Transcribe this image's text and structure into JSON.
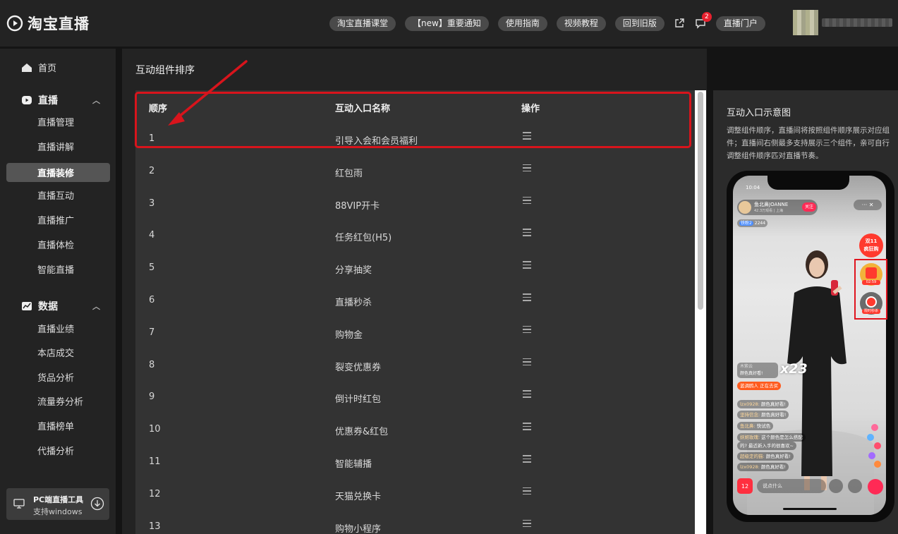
{
  "header": {
    "logo_text": "淘宝直播",
    "nav": [
      "淘宝直播课堂",
      "【new】重要通知",
      "使用指南",
      "视频教程",
      "回到旧版"
    ],
    "message_badge": "2",
    "portal_label": "直播门户"
  },
  "sidebar": {
    "home": "首页",
    "groups": [
      {
        "label": "直播",
        "items": [
          "直播管理",
          "直播讲解",
          "直播装修",
          "直播互动",
          "直播推广",
          "直播体检",
          "智能直播"
        ],
        "active": "直播装修"
      },
      {
        "label": "数据",
        "items": [
          "直播业绩",
          "本店成交",
          "货品分析",
          "流量券分析",
          "直播榜单",
          "代播分析"
        ]
      }
    ],
    "pc_tool": {
      "title": "PC端直播工具",
      "subtitle": "支持windows"
    }
  },
  "main": {
    "title": "互动组件排序",
    "columns": [
      "顺序",
      "互动入口名称",
      "操作"
    ],
    "rows": [
      {
        "order": "1",
        "name": "引导入会和会员福利"
      },
      {
        "order": "2",
        "name": "红包雨"
      },
      {
        "order": "3",
        "name": "88VIP开卡"
      },
      {
        "order": "4",
        "name": "任务红包(H5)"
      },
      {
        "order": "5",
        "name": "分享抽奖"
      },
      {
        "order": "6",
        "name": "直播秒杀"
      },
      {
        "order": "7",
        "name": "购物金"
      },
      {
        "order": "8",
        "name": "裂变优惠券"
      },
      {
        "order": "9",
        "name": "倒计时红包"
      },
      {
        "order": "10",
        "name": "优惠券&红包"
      },
      {
        "order": "11",
        "name": "智能辅播"
      },
      {
        "order": "12",
        "name": "天猫兑换卡"
      },
      {
        "order": "13",
        "name": "购物小程序"
      }
    ]
  },
  "preview": {
    "title": "互动入口示意图",
    "description": "调整组件顺序，直播间将按照组件顺序展示对应组件；直播间右侧最多支持展示三个组件，亲可自行调整组件顺序匹对直播节奏。",
    "phone": {
      "time": "10:04",
      "host_name": "鱼北鼻JOANNE",
      "host_sub": "42.3万观看 | 上海",
      "follow": "关注",
      "fans_tag": "铁粉2",
      "fans_count": "2244",
      "promo": [
        "双11",
        "疯狂购"
      ],
      "widget1_label": "02:59",
      "widget2_label": "限时秒杀",
      "gift_user": "木紫云",
      "gift_text": "颜色真好看!",
      "combo": "x23",
      "join_text": "蓝调鸥人 正在去买",
      "comments": [
        {
          "user": "lzx0928:",
          "text": "颜色真好看!"
        },
        {
          "user": "坚持信念:",
          "text": "颜色真好看!"
        },
        {
          "user": "鱼北鼻:",
          "text": "快试色"
        },
        {
          "user": "妖姬玫瑰:",
          "text": "这个颜色是怎么搭配"
        },
        {
          "user": "",
          "text": "的? 最近新入手的很喜欢~"
        },
        {
          "user": "超级定的猫:",
          "text": "颜色真好看!"
        },
        {
          "user": "lzx0928:",
          "text": "颜色真好看!"
        }
      ],
      "bag_count": "12",
      "input_placeholder": "说点什么"
    }
  },
  "colors": {
    "accent_red": "#d8141c",
    "bg": "#141414",
    "panel": "#232323",
    "table": "#333333"
  }
}
